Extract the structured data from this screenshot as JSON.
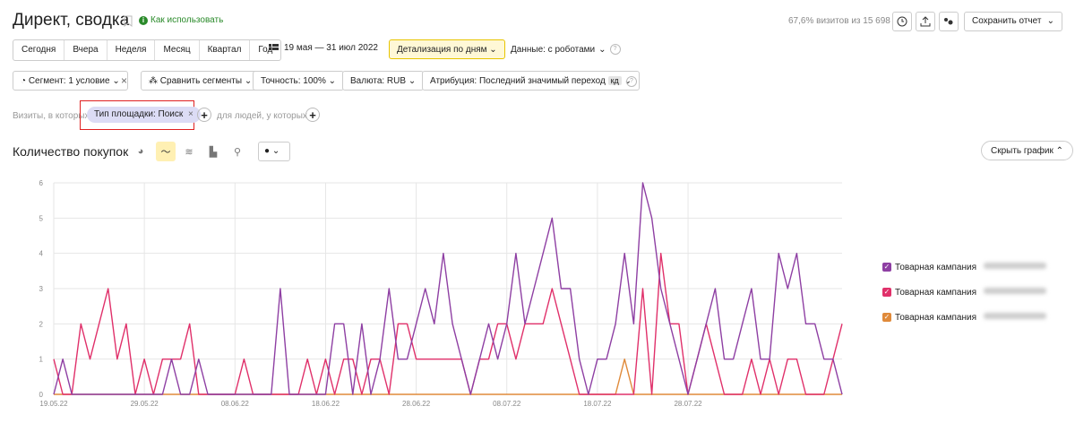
{
  "header": {
    "title": "Директ, сводка",
    "howto": "Как использовать",
    "visits_info": "67,6% визитов из 15 698",
    "save_label": "Сохранить отчет"
  },
  "periods": [
    "Сегодня",
    "Вчера",
    "Неделя",
    "Месяц",
    "Квартал",
    "Год"
  ],
  "date_range": "19 мая — 31 июл 2022",
  "detail_label": "Детализация по дням",
  "robots_label": "Данные: с роботами",
  "filters": {
    "segment": "Сегмент: 1 условие",
    "compare": "Сравнить сегменты",
    "accuracy": "Точность: 100%",
    "currency": "Валюта: RUB",
    "attribution": "Атрибуция: Последний значимый переход",
    "attribution_badge": "кд"
  },
  "segment_row": {
    "visits_label": "Визиты, в которых",
    "chip": "Тип площадки: Поиск",
    "people_label": "для людей, у которых"
  },
  "chart_section": {
    "title": "Количество покупок",
    "hide_label": "Скрыть график"
  },
  "colors": {
    "purple": "#8e3fa3",
    "pink": "#e0306a",
    "orange": "#e08a3a"
  },
  "chart_data": {
    "type": "line",
    "ylim": [
      0,
      6
    ],
    "yticks": [
      0,
      1,
      2,
      3,
      4,
      5,
      6
    ],
    "xticks": [
      "19.05.22",
      "29.05.22",
      "08.06.22",
      "18.06.22",
      "28.06.22",
      "08.07.22",
      "18.07.22",
      "28.07.22"
    ],
    "x_start": "19.05.22",
    "x_end": "31.07.22",
    "series": [
      {
        "name": "Товарная кампания",
        "color": "#8e3fa3",
        "values": [
          0,
          1,
          0,
          0,
          0,
          0,
          0,
          0,
          0,
          0,
          0,
          0,
          0,
          1,
          0,
          0,
          1,
          0,
          0,
          0,
          0,
          0,
          0,
          0,
          0,
          3,
          0,
          0,
          0,
          0,
          0,
          2,
          2,
          0,
          2,
          0,
          1,
          3,
          1,
          1,
          2,
          3,
          2,
          4,
          2,
          1,
          0,
          1,
          2,
          1,
          2,
          4,
          2,
          3,
          4,
          5,
          3,
          3,
          1,
          0,
          1,
          1,
          2,
          4,
          2,
          6,
          5,
          3,
          2,
          1,
          0,
          1,
          2,
          3,
          1,
          1,
          2,
          3,
          1,
          1,
          4,
          3,
          4,
          2,
          2,
          1,
          1,
          0
        ]
      },
      {
        "name": "Товарная кампания",
        "color": "#e0306a",
        "values": [
          1,
          0,
          0,
          2,
          1,
          2,
          3,
          1,
          2,
          0,
          1,
          0,
          1,
          1,
          1,
          2,
          0,
          0,
          0,
          0,
          0,
          1,
          0,
          0,
          0,
          0,
          0,
          0,
          1,
          0,
          1,
          0,
          1,
          1,
          0,
          1,
          1,
          0,
          2,
          2,
          1,
          1,
          1,
          1,
          1,
          1,
          0,
          1,
          1,
          2,
          2,
          1,
          2,
          2,
          2,
          3,
          2,
          1,
          0,
          0,
          0,
          0,
          0,
          0,
          0,
          3,
          0,
          4,
          2,
          2,
          0,
          1,
          2,
          1,
          0,
          0,
          0,
          1,
          0,
          1,
          0,
          1,
          1,
          0,
          0,
          0,
          1,
          2
        ]
      },
      {
        "name": "Товарная кампания",
        "color": "#e08a3a",
        "values": [
          0,
          0,
          0,
          0,
          0,
          0,
          0,
          0,
          0,
          0,
          0,
          0,
          0,
          0,
          0,
          0,
          0,
          0,
          0,
          0,
          0,
          0,
          0,
          0,
          0,
          0,
          0,
          0,
          0,
          0,
          0,
          0,
          0,
          0,
          0,
          0,
          0,
          0,
          0,
          0,
          0,
          0,
          0,
          0,
          0,
          0,
          0,
          0,
          0,
          0,
          0,
          0,
          0,
          0,
          0,
          0,
          0,
          0,
          0,
          0,
          0,
          0,
          0,
          1,
          0,
          0,
          0,
          0,
          0,
          0,
          0,
          0,
          0,
          0,
          0,
          0,
          0,
          0,
          0,
          0,
          0,
          0,
          0,
          0,
          0,
          0,
          0,
          0
        ]
      }
    ]
  }
}
